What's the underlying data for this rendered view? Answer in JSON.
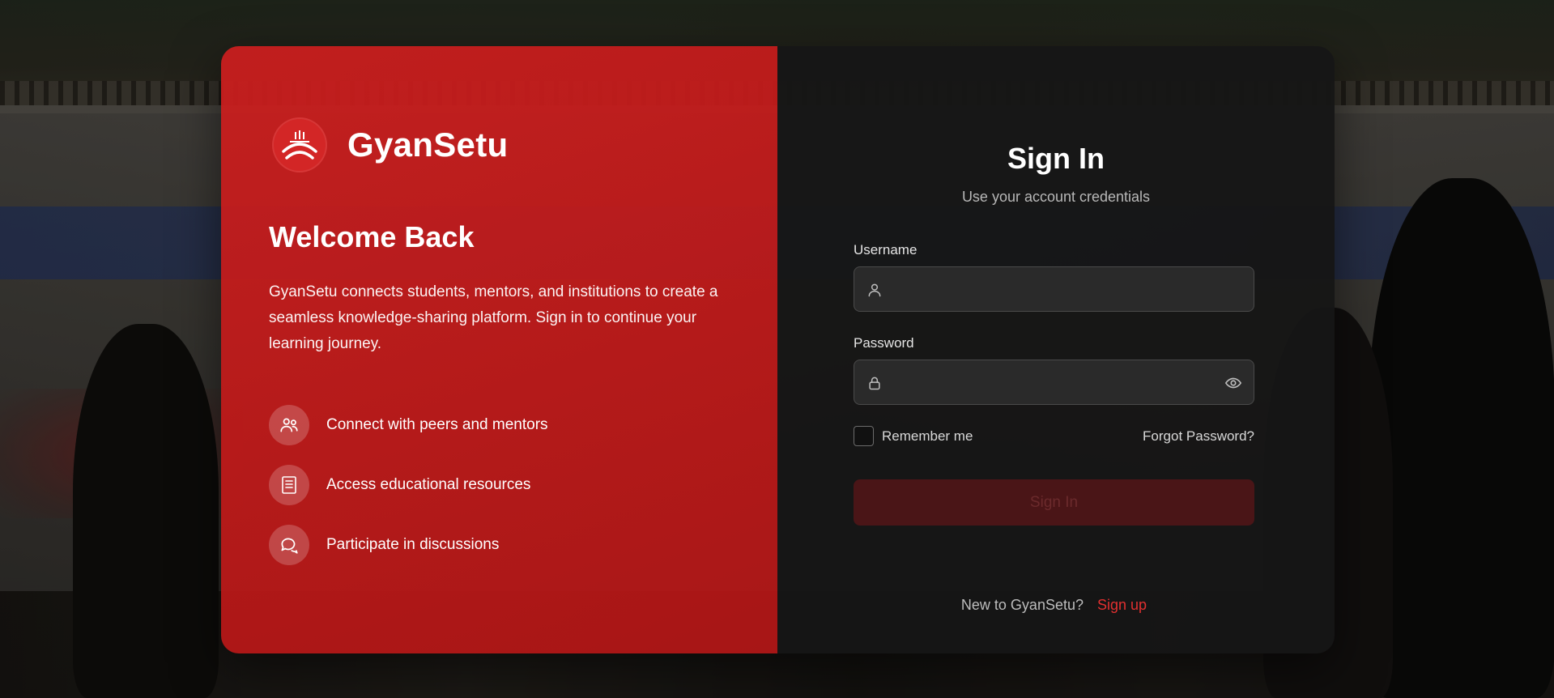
{
  "brand": {
    "name": "GyanSetu",
    "logo_icon": "bridge-logo-icon",
    "accent_color": "#d32626"
  },
  "welcome": {
    "heading": "Welcome Back",
    "description": "GyanSetu connects students, mentors, and institutions to create a seamless knowledge-sharing platform. Sign in to continue your learning journey."
  },
  "features": [
    {
      "icon": "people-icon",
      "label": "Connect with peers and mentors"
    },
    {
      "icon": "book-icon",
      "label": "Access educational resources"
    },
    {
      "icon": "chat-icon",
      "label": "Participate in discussions"
    }
  ],
  "signin": {
    "title": "Sign In",
    "subtitle": "Use your account credentials",
    "username_label": "Username",
    "username_value": "",
    "password_label": "Password",
    "password_value": "",
    "remember_label": "Remember me",
    "remember_checked": false,
    "forgot_label": "Forgot Password?",
    "submit_label": "Sign In",
    "new_user_text": "New to GyanSetu?",
    "signup_label": "Sign up"
  }
}
